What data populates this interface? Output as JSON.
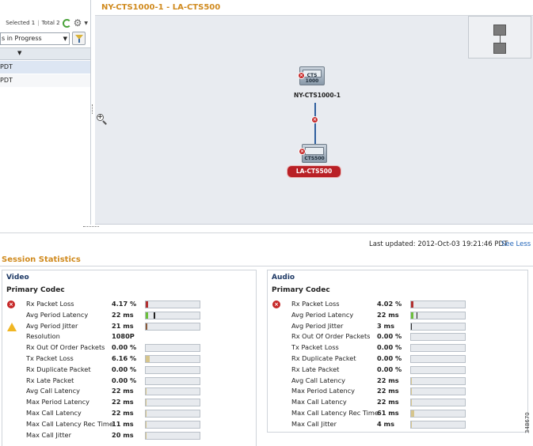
{
  "left_panel": {
    "selected_label": "Selected 1",
    "total_label": "Total 2",
    "filter_value": "s in Progress",
    "rows": [
      "PDT",
      "PDT"
    ]
  },
  "topology": {
    "title": "NY-CTS1000-1 - LA-CTS500",
    "device_a": {
      "screen_label": "CTS 1000",
      "name": "NY-CTS1000-1"
    },
    "device_b": {
      "screen_label": "CTS500",
      "name": "LA-CTS500"
    }
  },
  "stats": {
    "last_updated": "Last updated: 2012-Oct-03 19:21:46 PDT",
    "see_less": "See Less",
    "title": "Session Statistics",
    "video": {
      "title": "Video",
      "subtitle": "Primary Codec",
      "metrics": [
        {
          "name": "Rx Packet Loss",
          "value": "4.17 %",
          "status": "error",
          "bar": {
            "fill": 0.05,
            "color": "#b23030",
            "mark": null
          }
        },
        {
          "name": "Avg Period Latency",
          "value": "22 ms",
          "status": "ok",
          "bar": {
            "fill": 0.05,
            "color": "#6cbf3b",
            "mark": 0.15
          }
        },
        {
          "name": "Avg Period Jitter",
          "value": "21 ms",
          "status": "warning",
          "bar": {
            "fill": 0.03,
            "color": "#8a5a3a",
            "mark": null
          }
        },
        {
          "name": "Resolution",
          "value": "1080P",
          "status": "ok",
          "bar": null
        },
        {
          "name": "Rx Out Of Order Packets",
          "value": "0.00 %",
          "status": "ok",
          "bar": {
            "fill": 0,
            "color": "#d6c58c",
            "mark": null
          }
        },
        {
          "name": "Tx Packet Loss",
          "value": "6.16 %",
          "status": "ok",
          "bar": {
            "fill": 0.07,
            "color": "#d6c58c",
            "mark": null
          }
        },
        {
          "name": "Rx Duplicate Packet",
          "value": "0.00 %",
          "status": "ok",
          "bar": {
            "fill": 0,
            "color": "#d6c58c",
            "mark": null
          }
        },
        {
          "name": "Rx Late Packet",
          "value": "0.00 %",
          "status": "ok",
          "bar": {
            "fill": 0,
            "color": "#d6c58c",
            "mark": null
          }
        },
        {
          "name": "Avg Call Latency",
          "value": "22 ms",
          "status": "ok",
          "bar": {
            "fill": 0.02,
            "color": "#d6c58c",
            "mark": null
          }
        },
        {
          "name": "Max Period Latency",
          "value": "22 ms",
          "status": "ok",
          "bar": {
            "fill": 0.02,
            "color": "#d6c58c",
            "mark": null
          }
        },
        {
          "name": "Max Call Latency",
          "value": "22 ms",
          "status": "ok",
          "bar": {
            "fill": 0.02,
            "color": "#d6c58c",
            "mark": null
          }
        },
        {
          "name": "Max Call Latency Rec Time",
          "value": "11 ms",
          "status": "ok",
          "bar": {
            "fill": 0.01,
            "color": "#d6c58c",
            "mark": null
          }
        },
        {
          "name": "Max Call Jitter",
          "value": "20 ms",
          "status": "ok",
          "bar": {
            "fill": 0.02,
            "color": "#d6c58c",
            "mark": null
          }
        }
      ]
    },
    "audio": {
      "title": "Audio",
      "subtitle": "Primary Codec",
      "metrics": [
        {
          "name": "Rx Packet Loss",
          "value": "4.02 %",
          "status": "error",
          "bar": {
            "fill": 0.05,
            "color": "#b23030",
            "mark": null
          }
        },
        {
          "name": "Avg Period Latency",
          "value": "22 ms",
          "status": "ok",
          "bar": {
            "fill": 0.05,
            "color": "#6cbf3b",
            "mark": 0.1
          }
        },
        {
          "name": "Avg Period Jitter",
          "value": "3 ms",
          "status": "ok",
          "bar": {
            "fill": 0.02,
            "color": "#2a2a2a",
            "mark": null
          }
        },
        {
          "name": "Rx Out Of Order Packets",
          "value": "0.00 %",
          "status": "ok",
          "bar": {
            "fill": 0,
            "color": "#d6c58c",
            "mark": null
          }
        },
        {
          "name": "Tx Packet Loss",
          "value": "0.00 %",
          "status": "ok",
          "bar": {
            "fill": 0,
            "color": "#d6c58c",
            "mark": null
          }
        },
        {
          "name": "Rx Duplicate Packet",
          "value": "0.00 %",
          "status": "ok",
          "bar": {
            "fill": 0,
            "color": "#d6c58c",
            "mark": null
          }
        },
        {
          "name": "Rx Late Packet",
          "value": "0.00 %",
          "status": "ok",
          "bar": {
            "fill": 0,
            "color": "#d6c58c",
            "mark": null
          }
        },
        {
          "name": "Avg Call Latency",
          "value": "22 ms",
          "status": "ok",
          "bar": {
            "fill": 0.02,
            "color": "#d6c58c",
            "mark": null
          }
        },
        {
          "name": "Max Period Latency",
          "value": "22 ms",
          "status": "ok",
          "bar": {
            "fill": 0.02,
            "color": "#d6c58c",
            "mark": null
          }
        },
        {
          "name": "Max Call Latency",
          "value": "22 ms",
          "status": "ok",
          "bar": {
            "fill": 0.02,
            "color": "#d6c58c",
            "mark": null
          }
        },
        {
          "name": "Max Call Latency Rec Time",
          "value": "61 ms",
          "status": "ok",
          "bar": {
            "fill": 0.06,
            "color": "#d6c58c",
            "mark": null
          }
        },
        {
          "name": "Max Call Jitter",
          "value": "4 ms",
          "status": "ok",
          "bar": {
            "fill": 0.01,
            "color": "#d6c58c",
            "mark": null
          }
        }
      ]
    }
  },
  "figure_number": "348670"
}
